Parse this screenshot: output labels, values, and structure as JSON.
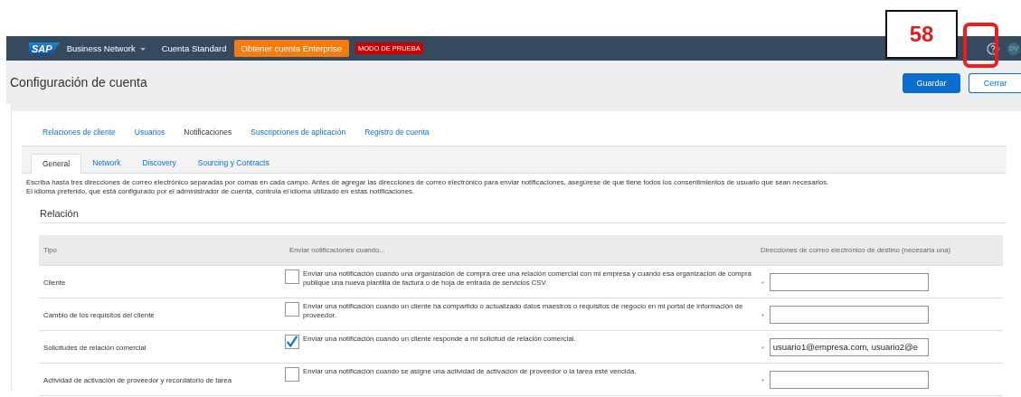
{
  "top_bar": {
    "logo": "SAP",
    "product": "Business Network",
    "account_type": "Cuenta Standard",
    "upgrade_button": "Obtener cuenta Enterprise",
    "mode_badge": "MODO DE PRUEBA",
    "avatar": "DV"
  },
  "annotation": {
    "step_number": "58"
  },
  "page": {
    "title": "Configuración de cuenta",
    "buttons": [
      {
        "label": "Guardar",
        "kind": "primary"
      },
      {
        "label": "Cerrar",
        "kind": "secondary"
      }
    ]
  },
  "section_tabs": [
    {
      "label": "Relaciones de cliente",
      "selected": false
    },
    {
      "label": "Usuarios",
      "selected": false
    },
    {
      "label": "Notificaciones",
      "selected": true
    },
    {
      "label": "Suscripciones de aplicación",
      "selected": false
    },
    {
      "label": "Registro de cuenta",
      "selected": false
    }
  ],
  "sub_tabs": [
    {
      "label": "General",
      "selected": true
    },
    {
      "label": "Network",
      "selected": false
    },
    {
      "label": "Discovery",
      "selected": false
    },
    {
      "label": "Sourcing y Contracts",
      "selected": false
    }
  ],
  "intro": [
    "Escriba hasta tres direcciones de correo electrónico separadas por comas en cada campo. Antes de agregar las direcciones de correo electrónico para enviar notificaciones, asegúrese de que tiene todos los consentimientos de usuario que sean necesarios.",
    "El idioma preferido, que está configurado por el administrador de cuenta, controla el idioma utilizado en estas notificaciones."
  ],
  "section_heading": "Relación",
  "table": {
    "columns": [
      "Tipo",
      "Enviar notificaciones cuando...",
      "Direcciones de correo electrónico de destino (necesaria una)"
    ],
    "rows": [
      {
        "type": "Cliente",
        "description": "Enviar una notificación cuando una organización de compra cree una relación comercial con mi empresa y cuando esa organización de compra publique una nueva plantilla de factura o de hoja de entrada de servicios CSV.",
        "checked": false,
        "required_mark": "*",
        "email": ""
      },
      {
        "type": "Cambio de los requisitos del cliente",
        "description": "Enviar una notificación cuando un cliente ha compartido o actualizado datos maestros o requisitos de negocio en mi portal de información de proveedor.",
        "checked": false,
        "required_mark": "*",
        "email": ""
      },
      {
        "type": "Solicitudes de relación comercial",
        "description": "Enviar una notificación cuando un cliente responde a mi solicitud de relación comercial.",
        "checked": true,
        "required_mark": "*",
        "email": "usuario1@empresa.com, usuario2@e"
      },
      {
        "type": "Actividad de activación de proveedor y recordatorio de tarea",
        "description": "Enviar una notificación cuando se asigne una actividad de activación de proveedor o la tarea esté vencida.",
        "checked": false,
        "required_mark": "*",
        "email": ""
      }
    ]
  }
}
